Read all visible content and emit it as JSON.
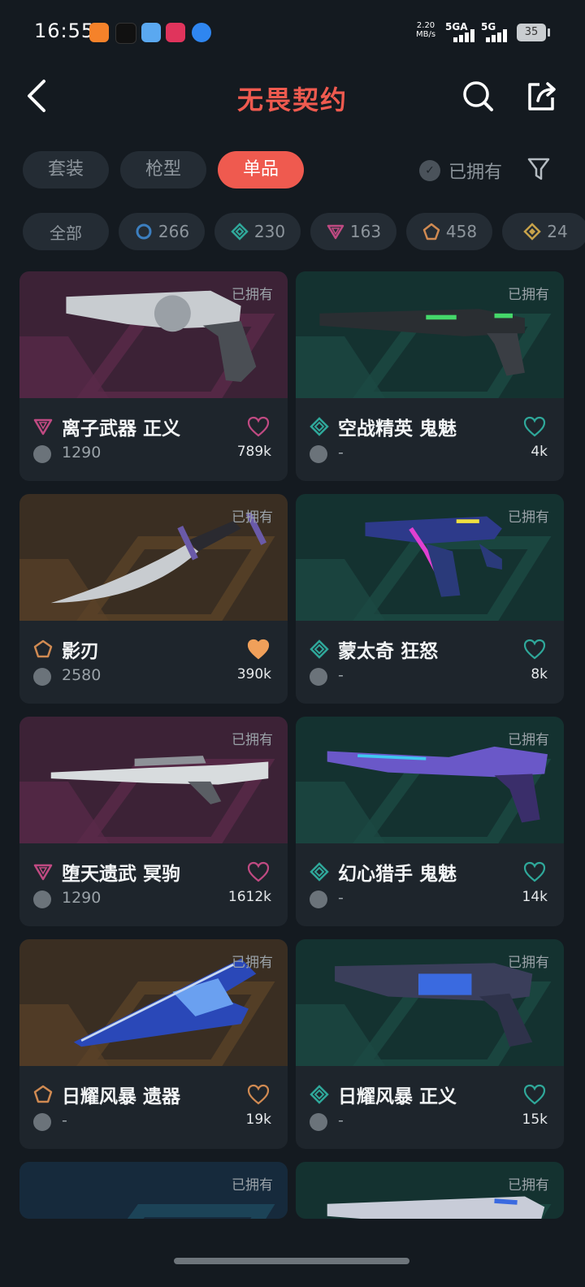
{
  "status_bar": {
    "time": "16:55",
    "net_speed_value": "2.20",
    "net_speed_unit": "MB/s",
    "sim1": "5GA",
    "sim2": "5G",
    "battery": "35"
  },
  "header": {
    "title": "无畏契约"
  },
  "tabs": [
    {
      "label": "套装",
      "active": false
    },
    {
      "label": "枪型",
      "active": false
    },
    {
      "label": "单品",
      "active": true
    }
  ],
  "owned_filter": {
    "label": "已拥有"
  },
  "rarity_chips": [
    {
      "label": "全部"
    },
    {
      "icon": "circle-rarity-icon",
      "label": "266",
      "color": "#3c7fc0"
    },
    {
      "icon": "diamond-rarity-icon",
      "label": "230",
      "color": "#2fa89a"
    },
    {
      "icon": "triangle-rarity-icon",
      "label": "163",
      "color": "#c04a82"
    },
    {
      "icon": "pentagon-rarity-icon",
      "label": "458",
      "color": "#d08a52"
    },
    {
      "icon": "diamond-gold-rarity-icon",
      "label": "24",
      "color": "#c7a24a"
    }
  ],
  "items": [
    {
      "owned_label": "已拥有",
      "name": "离子武器 正义",
      "price": "1290",
      "likes": "789k",
      "rarity": "triangle",
      "liked": false,
      "bg": "purple",
      "weapon": "revolver"
    },
    {
      "owned_label": "已拥有",
      "name": "空战精英 鬼魅",
      "price": "-",
      "likes": "4k",
      "rarity": "diamond",
      "liked": false,
      "bg": "teal",
      "weapon": "pistol"
    },
    {
      "owned_label": "已拥有",
      "name": "影刃",
      "price": "2580",
      "likes": "390k",
      "rarity": "pentagon",
      "liked": true,
      "bg": "brown",
      "weapon": "knife"
    },
    {
      "owned_label": "已拥有",
      "name": "蒙太奇 狂怒",
      "price": "-",
      "likes": "8k",
      "rarity": "diamond",
      "liked": false,
      "bg": "teal",
      "weapon": "smg"
    },
    {
      "owned_label": "已拥有",
      "name": "堕天遗武 冥驹",
      "price": "1290",
      "likes": "1612k",
      "rarity": "triangle",
      "liked": false,
      "bg": "purple",
      "weapon": "sniper"
    },
    {
      "owned_label": "已拥有",
      "name": "幻心猎手 鬼魅",
      "price": "-",
      "likes": "14k",
      "rarity": "diamond",
      "liked": false,
      "bg": "teal",
      "weapon": "pistol2"
    },
    {
      "owned_label": "已拥有",
      "name": "日耀风暴 遗器",
      "price": "-",
      "likes": "19k",
      "rarity": "pentagon",
      "liked": false,
      "bg": "brown",
      "weapon": "blade"
    },
    {
      "owned_label": "已拥有",
      "name": "日耀风暴 正义",
      "price": "-",
      "likes": "15k",
      "rarity": "diamond",
      "liked": false,
      "bg": "teal",
      "weapon": "revolver2"
    },
    {
      "owned_label": "已拥有",
      "name": "",
      "price": "",
      "likes": "",
      "rarity": "",
      "liked": false,
      "bg": "blue",
      "weapon": "sniper2"
    },
    {
      "owned_label": "已拥有",
      "name": "",
      "price": "",
      "likes": "",
      "rarity": "",
      "liked": false,
      "bg": "teal",
      "weapon": "rifle"
    }
  ],
  "colors": {
    "accent": "#ef5a4f",
    "triangle": "#c04a82",
    "diamond": "#2fa89a",
    "pentagon": "#d08a52",
    "heart_liked": "#f0a05a"
  }
}
